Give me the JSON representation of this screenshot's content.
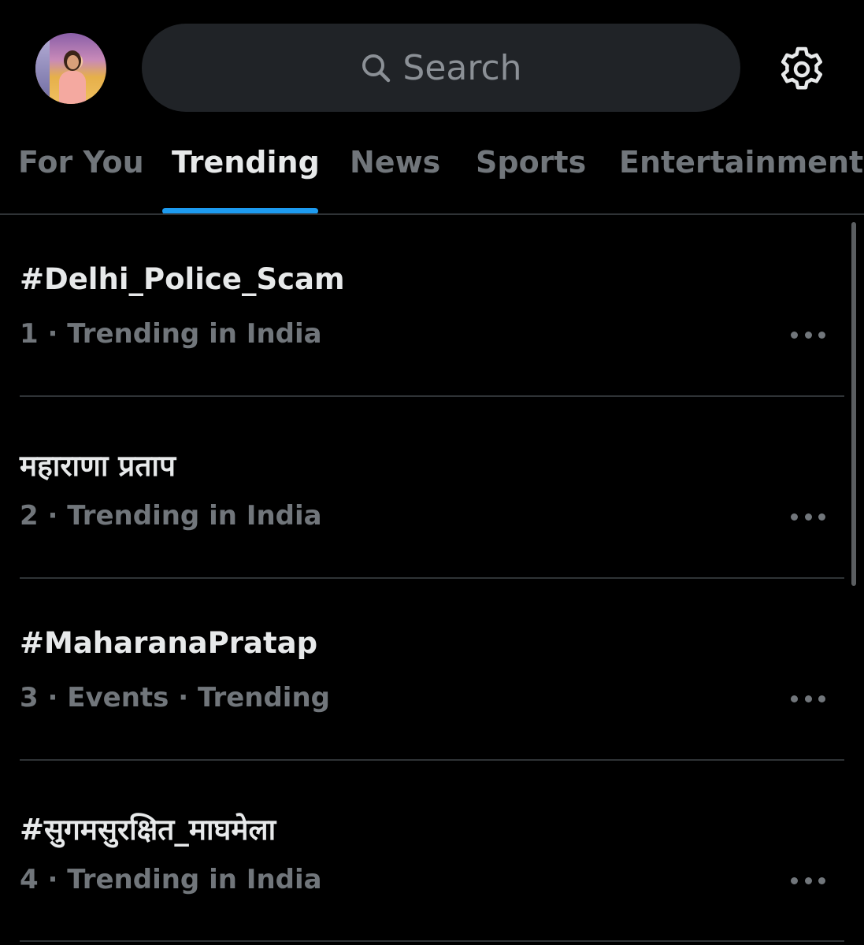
{
  "header": {
    "search_placeholder": "Search",
    "avatar_icon": "profile-avatar",
    "settings_icon": "gear-icon"
  },
  "tabs": [
    {
      "label": "For You",
      "active": false
    },
    {
      "label": "Trending",
      "active": true
    },
    {
      "label": "News",
      "active": false
    },
    {
      "label": "Sports",
      "active": false
    },
    {
      "label": "Entertainment",
      "active": false
    }
  ],
  "trends": [
    {
      "title": "#Delhi_Police_Scam",
      "meta": "1 · Trending in India"
    },
    {
      "title": "महाराणा प्रताप",
      "meta": "2 · Trending in India"
    },
    {
      "title": "#MaharanaPratap",
      "meta": "3 · Events · Trending"
    },
    {
      "title": "#सुगमसुरक्षित_माघमेला",
      "meta": "4 · Trending in India"
    }
  ],
  "colors": {
    "background": "#000000",
    "accent": "#1d9bf0",
    "primary_text": "#e7e9ea",
    "secondary_text": "#71767b",
    "search_bg": "#202327"
  }
}
